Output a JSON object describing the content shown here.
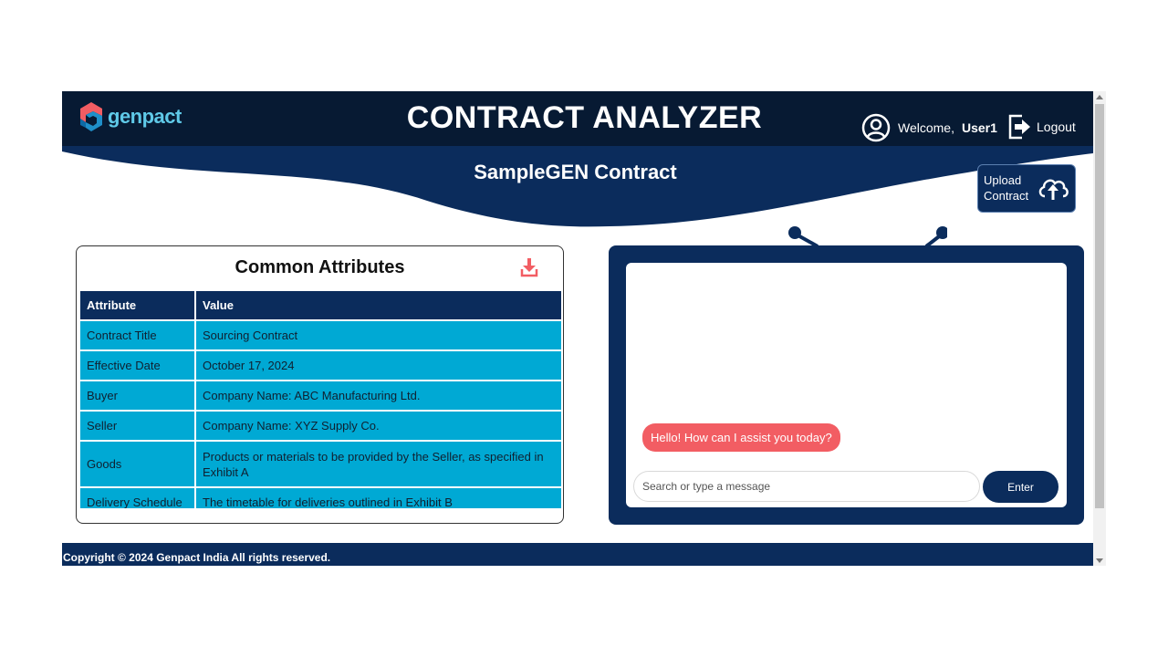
{
  "header": {
    "brand": "genpact",
    "app_title": "CONTRACT ANALYZER",
    "welcome_label": "Welcome,",
    "user_name": "User1",
    "logout_label": "Logout"
  },
  "banner": {
    "contract_name": "SampleGEN Contract",
    "upload_label": "Upload Contract"
  },
  "attributes": {
    "title": "Common Attributes",
    "columns": [
      "Attribute",
      "Value"
    ],
    "rows": [
      {
        "attribute": "Contract Title",
        "value": "Sourcing Contract"
      },
      {
        "attribute": "Effective Date",
        "value": "October 17, 2024"
      },
      {
        "attribute": "Buyer",
        "value": "Company Name: ABC Manufacturing Ltd."
      },
      {
        "attribute": "Seller",
        "value": "Company Name: XYZ Supply Co."
      },
      {
        "attribute": "Goods",
        "value": "Products or materials to be provided by the Seller, as specified in Exhibit A"
      },
      {
        "attribute": "Delivery Schedule",
        "value": "The timetable for deliveries outlined in Exhibit B"
      }
    ]
  },
  "chat": {
    "greeting": "Hello! How can I assist you today?",
    "input_placeholder": "Search or type a message",
    "enter_label": "Enter"
  },
  "footer": {
    "copyright": "Copyright © 2024 Genpact India All rights reserved."
  },
  "colors": {
    "navy": "#0b2c5c",
    "dark_navy": "#071a33",
    "cyan": "#00a9d4",
    "coral": "#f25d63",
    "logo_cyan": "#5fc9e8"
  },
  "icons": [
    "genpact-logo-icon",
    "user-circle-icon",
    "logout-icon",
    "cloud-upload-icon",
    "download-icon",
    "antenna-icon"
  ]
}
